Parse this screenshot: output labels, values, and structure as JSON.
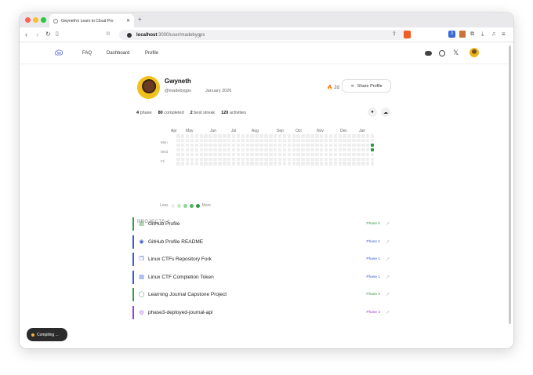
{
  "browser": {
    "tab_title": "Gwyneth's Learn to Cloud Pro",
    "url_host": "localhost",
    "url_path": ":3000/user/madebygps",
    "ext_badge": "3"
  },
  "nav": {
    "links": [
      "FAQ",
      "Dashboard",
      "Profile"
    ],
    "icons": [
      "discord-icon",
      "github-icon",
      "x-icon"
    ]
  },
  "profile": {
    "name": "Gwyneth",
    "handle": "@madebygps",
    "joined": "January 2026",
    "streak_days": "2d",
    "share_label": "Share Profile"
  },
  "stats": [
    {
      "value": "4",
      "label": "phase"
    },
    {
      "value": "80",
      "label": "completed"
    },
    {
      "value": "2",
      "label": "best streak"
    },
    {
      "value": "120",
      "label": "activities"
    }
  ],
  "heatmap": {
    "months": [
      "Apr",
      "May",
      "Jun",
      "Jul",
      "Aug",
      "Sep",
      "Oct",
      "Nov",
      "Dec",
      "Jan"
    ],
    "days": [
      "Mon",
      "Wed",
      "Fri"
    ],
    "legend_less": "Less",
    "legend_more": "More",
    "legend_colors": [
      "#eeeeee",
      "#c6e9c9",
      "#8fd49a",
      "#4cb85c",
      "#2e9a43"
    ]
  },
  "projects": {
    "header": "PROJECTS",
    "count": "6",
    "items": [
      {
        "title": "GitHub Profile",
        "phase": "Phase 0",
        "icon": "document-icon",
        "color": "#3a9a4a"
      },
      {
        "title": "GitHub Profile README",
        "phase": "Phase 1",
        "icon": "github-icon",
        "color": "#3b5bd6"
      },
      {
        "title": "Linux CTFs Repository Fork",
        "phase": "Phase 1",
        "icon": "copy-icon",
        "color": "#3b5bd6"
      },
      {
        "title": "Linux CTF Completion Token",
        "phase": "Phase 1",
        "icon": "document-icon",
        "color": "#3b5bd6"
      },
      {
        "title": "Learning Journal Capstone Project",
        "phase": "Phase 2",
        "icon": "chat-icon",
        "color": "#3a9a4a"
      },
      {
        "title": "phase3-deployed-journal-api",
        "phase": "Phase 3",
        "icon": "globe-icon",
        "color": "#9b3fd6"
      }
    ]
  },
  "toast": {
    "label": "Compiling ..."
  }
}
